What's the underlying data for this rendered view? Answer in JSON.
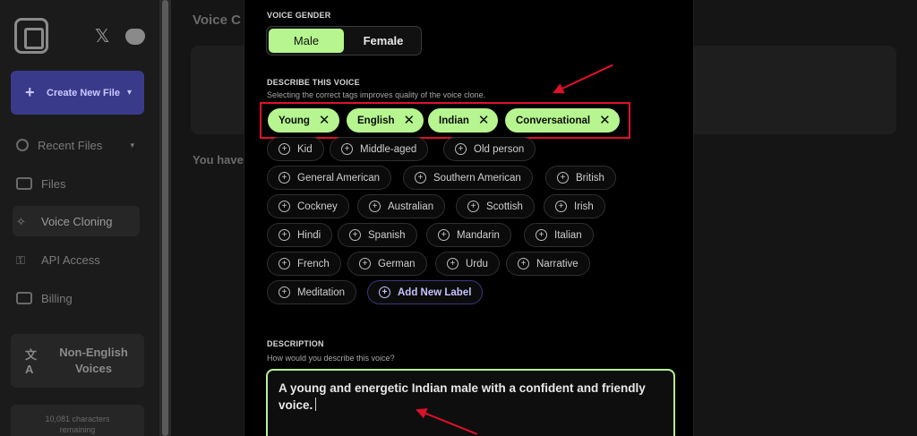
{
  "sidebar": {
    "social": {
      "x_icon": "𝕏"
    },
    "create_button": {
      "label": "Create New File"
    },
    "items": [
      {
        "label": "Recent Files",
        "icon": "clock-icon"
      },
      {
        "label": "Files",
        "icon": "folder-icon"
      },
      {
        "label": "Voice Cloning",
        "icon": "sparkle-icon"
      },
      {
        "label": "API Access",
        "icon": "key-icon"
      },
      {
        "label": "Billing",
        "icon": "card-icon"
      }
    ],
    "language_box": {
      "label": "Non-English Voices",
      "icon": "translate-icon"
    },
    "characters": {
      "line1": "10,081 characters",
      "line2": "remaining"
    }
  },
  "background": {
    "title": "Voice C",
    "text": "You have"
  },
  "modal": {
    "gender": {
      "label": "VOICE GENDER",
      "options": [
        "Male",
        "Female"
      ],
      "selected": "Male"
    },
    "describe": {
      "label": "DESCRIBE THIS VOICE",
      "subtitle": "Selecting the correct tags improves quality of the voice clone.",
      "selected_tags": [
        "Young",
        "English",
        "Indian",
        "Conversational"
      ],
      "available_tags": [
        "Kid",
        "Middle-aged",
        "Old person",
        "General American",
        "Southern American",
        "British",
        "Cockney",
        "Australian",
        "Scottish",
        "Irish",
        "Hindi",
        "Spanish",
        "Mandarin",
        "Italian",
        "French",
        "German",
        "Urdu",
        "Narrative",
        "Meditation"
      ],
      "add_label": "Add New Label"
    },
    "description": {
      "label": "DESCRIPTION",
      "subtitle": "How would you describe this voice?",
      "value": "A young and energetic Indian male with a confident and friendly voice."
    }
  },
  "colors": {
    "accent_green": "#b6f58f",
    "annotation_red": "#e0102a",
    "add_label_purple": "#c7c2ff"
  }
}
